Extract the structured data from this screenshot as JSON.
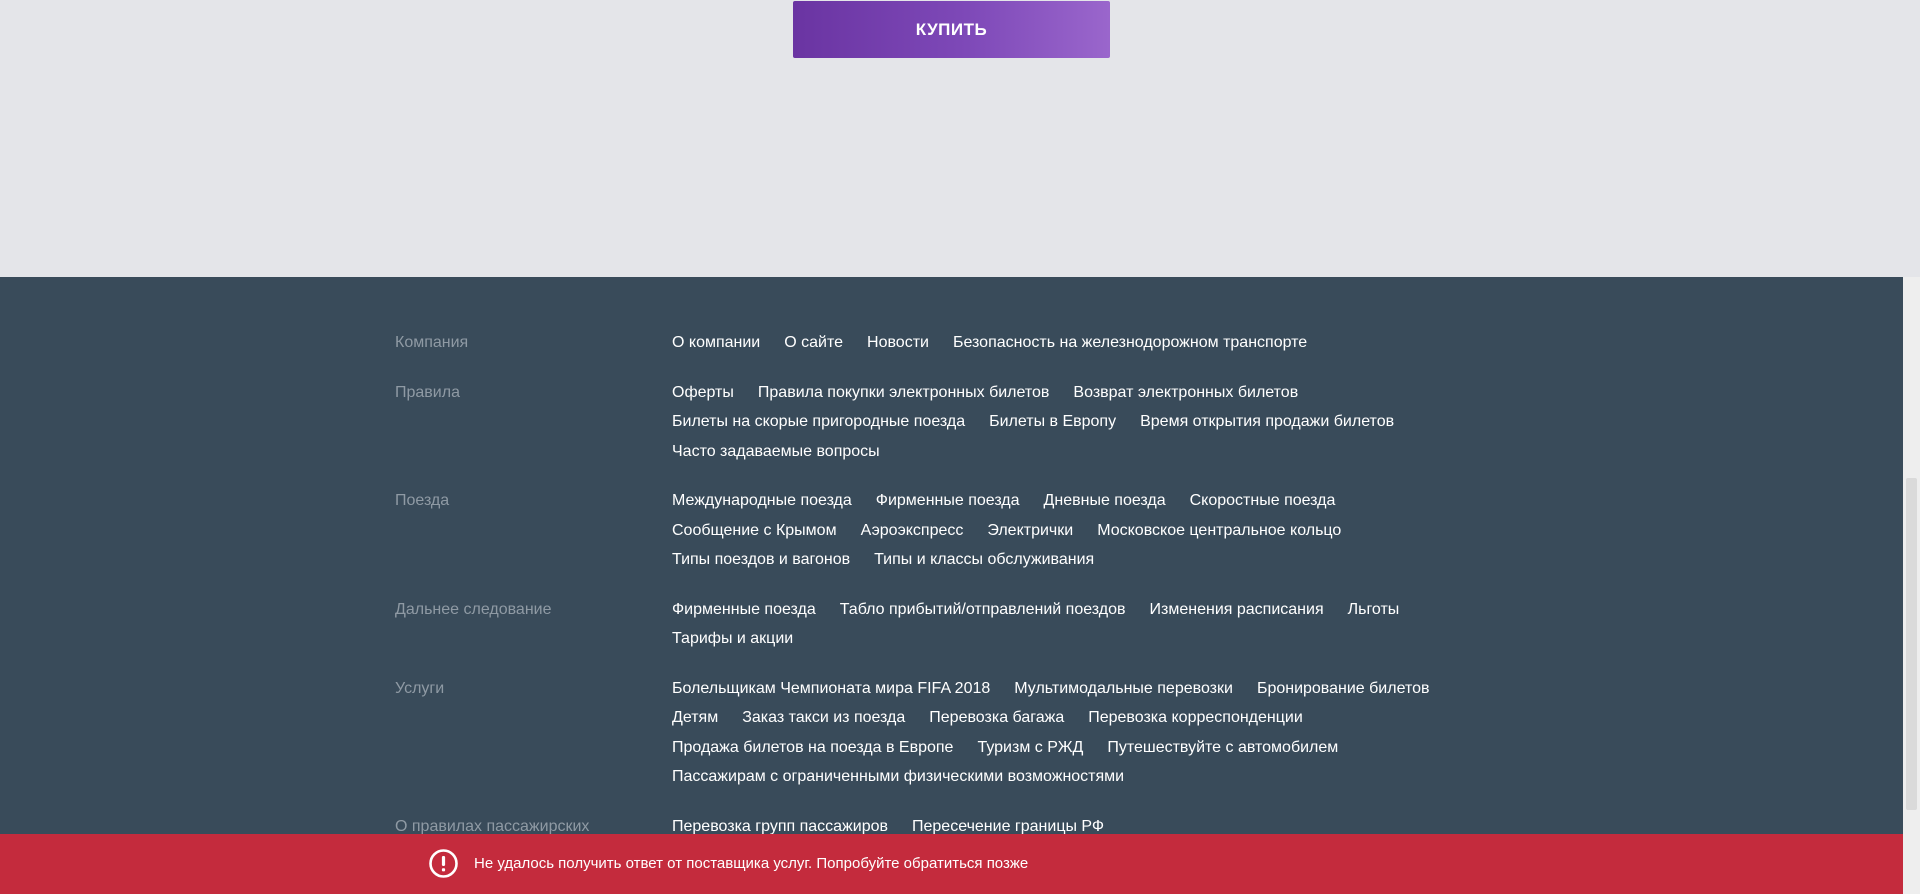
{
  "buy_button": {
    "label": "КУПИТЬ"
  },
  "footer": {
    "sections": [
      {
        "title": "Компания",
        "rows": [
          [
            "О компании",
            "О сайте",
            "Новости",
            "Безопасность на железнодорожном транспорте"
          ]
        ]
      },
      {
        "title": "Правила",
        "rows": [
          [
            "Оферты",
            "Правила покупки электронных билетов",
            "Возврат электронных билетов"
          ],
          [
            "Билеты на скорые пригородные поезда",
            "Билеты в Европу",
            "Время открытия продажи билетов"
          ],
          [
            "Часто задаваемые вопросы"
          ]
        ]
      },
      {
        "title": "Поезда",
        "rows": [
          [
            "Международные поезда",
            "Фирменные поезда",
            "Дневные поезда",
            "Скоростные поезда"
          ],
          [
            "Сообщение с Крымом",
            "Аэроэкспресс",
            "Электрички",
            "Московское центральное кольцо"
          ],
          [
            "Типы поездов и вагонов",
            "Типы и классы обслуживания"
          ]
        ]
      },
      {
        "title": "Дальнее следование",
        "rows": [
          [
            "Фирменные поезда",
            "Табло прибытий/отправлений поездов",
            "Изменения расписания",
            "Льготы"
          ],
          [
            "Тарифы и акции"
          ]
        ]
      },
      {
        "title": "Услуги",
        "rows": [
          [
            "Болельщикам Чемпионата мира FIFA 2018",
            "Мультимодальные перевозки",
            "Бронирование билетов"
          ],
          [
            "Детям",
            "Заказ такси из поезда",
            "Перевозка багажа",
            "Перевозка корреспонденции"
          ],
          [
            "Продажа билетов на поезда в Европе",
            "Туризм с РЖД",
            "Путешествуйте с автомобилем"
          ],
          [
            "Пассажирам с ограниченными физическими возможностями"
          ]
        ]
      },
      {
        "title": "О правилах пассажирских",
        "rows": [
          [
            "Перевозка групп пассажиров",
            "Пересечение границы РФ"
          ]
        ]
      }
    ]
  },
  "error": {
    "icon": "exclamation-circle-icon",
    "message": "Не удалось получить ответ от поставщика услуг. Попробуйте обратиться позже"
  },
  "colors": {
    "accent_purple": "#6a34a2",
    "footer_bg": "#394b5a",
    "error_bg": "#c42b3d",
    "page_bg": "#e4e5e9"
  }
}
